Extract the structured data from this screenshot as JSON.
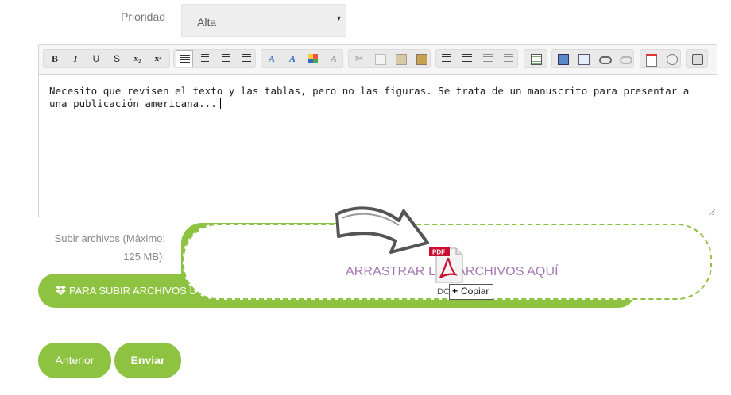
{
  "priority": {
    "label": "Prioridad",
    "value": "Alta",
    "caret": "▾"
  },
  "editor": {
    "toolbar": {
      "bold": "B",
      "italic": "I",
      "underline": "U",
      "strike": "S",
      "subscript": "x₂",
      "superscript": "x²"
    },
    "content": "Necesito que revisen el texto y las tablas, pero no las figuras. Se trata de un manuscrito para presentar a una publicación americana..."
  },
  "upload": {
    "label": "Subir archivos (Máximo: 125 MB):",
    "button_label": "PARA SUBIR ARCHIVOS D",
    "dropzone_text": "ARRASTRAR LOS ARCHIVOS AQUÍ",
    "drag_copy_label": "Copiar",
    "drag_copy_prefix": "+",
    "ghost_label": "DC",
    "pdf_badge": "PDF"
  },
  "buttons": {
    "prev": "Anterior",
    "send": "Enviar"
  },
  "colors": {
    "accent": "#8dc341",
    "dropzone_text": "#a77ab3",
    "pdf_red": "#c8102e"
  }
}
